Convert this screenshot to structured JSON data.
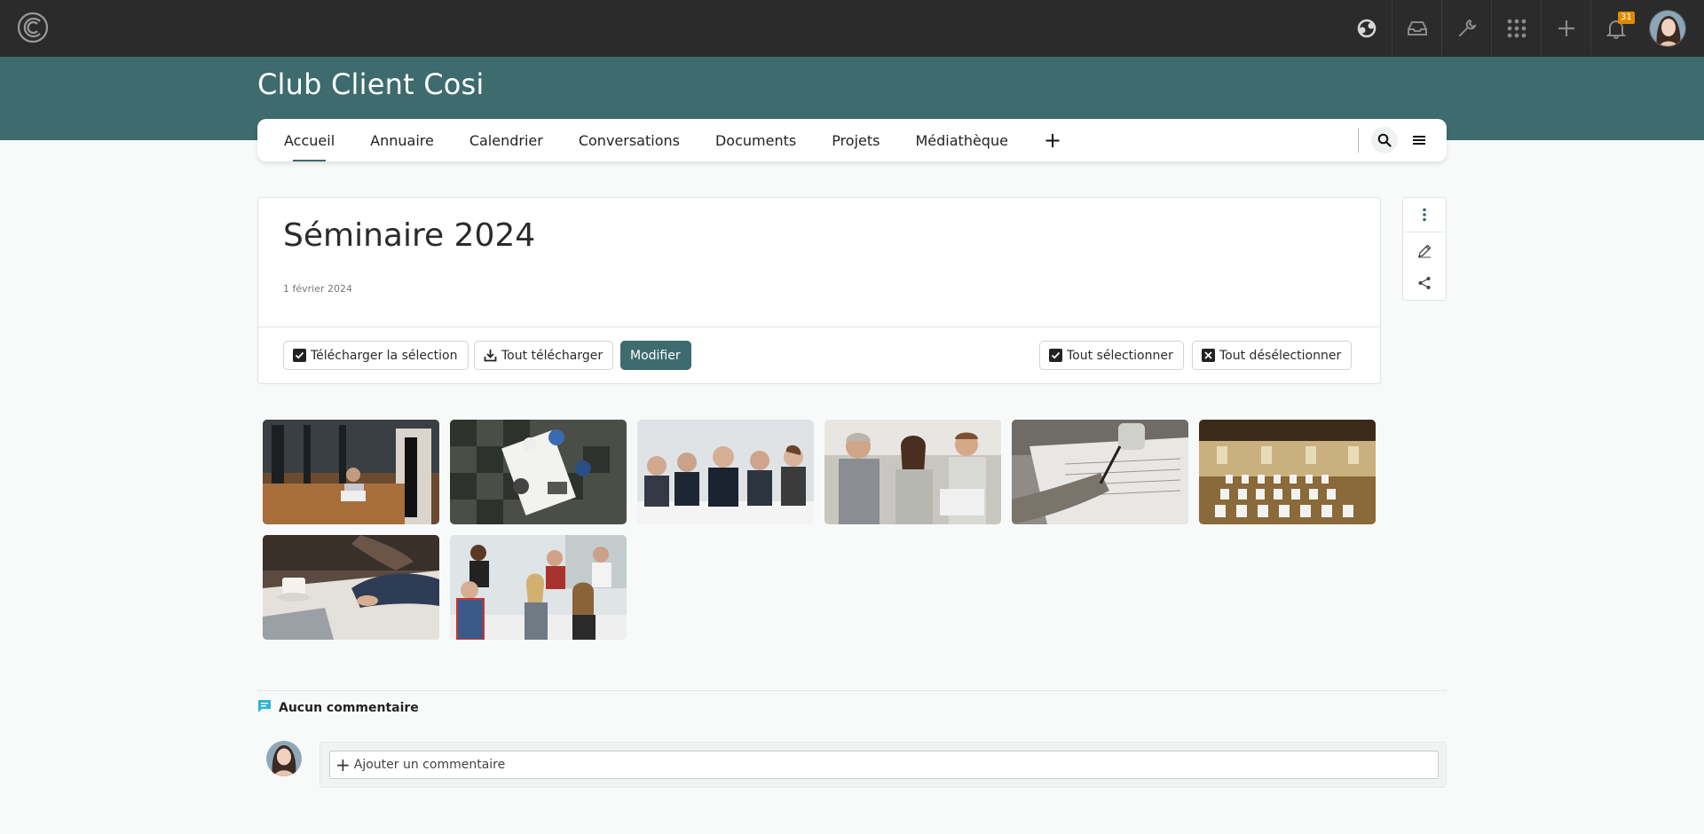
{
  "space": {
    "title": "Club Client Cosi"
  },
  "topbar": {
    "icons": [
      "users-sync-icon",
      "inbox-tray-icon",
      "wrench-icon",
      "apps-grid-icon",
      "plus-icon",
      "bell-icon"
    ],
    "notification_count": "31",
    "accent": "#e08a00"
  },
  "nav": {
    "tabs": [
      {
        "label": "Accueil",
        "active": true
      },
      {
        "label": "Annuaire"
      },
      {
        "label": "Calendrier"
      },
      {
        "label": "Conversations"
      },
      {
        "label": "Documents"
      },
      {
        "label": "Projets"
      },
      {
        "label": "Médiathèque"
      }
    ],
    "add_label": "+"
  },
  "album": {
    "title": "Séminaire 2024",
    "date": "1 février 2024",
    "buttons": {
      "download_selection": "Télécharger la sélection",
      "download_all": "Tout télécharger",
      "edit": "Modifier",
      "select_all": "Tout sélectionner",
      "deselect_all": "Tout désélectionner"
    },
    "photos": [
      {
        "subject": "woman-at-laptop-library"
      },
      {
        "subject": "overhead-meeting-table"
      },
      {
        "subject": "business-team-smiling"
      },
      {
        "subject": "colleagues-at-laptop"
      },
      {
        "subject": "hand-writing-notes"
      },
      {
        "subject": "conference-room-chairs"
      },
      {
        "subject": "hands-laptop-coffee"
      },
      {
        "subject": "casual-team-meeting"
      }
    ]
  },
  "comments": {
    "heading": "Aucun commentaire",
    "placeholder": "Ajouter un commentaire"
  },
  "colors": {
    "brand": "#3d6b6e",
    "topbar": "#2b2b2b"
  }
}
